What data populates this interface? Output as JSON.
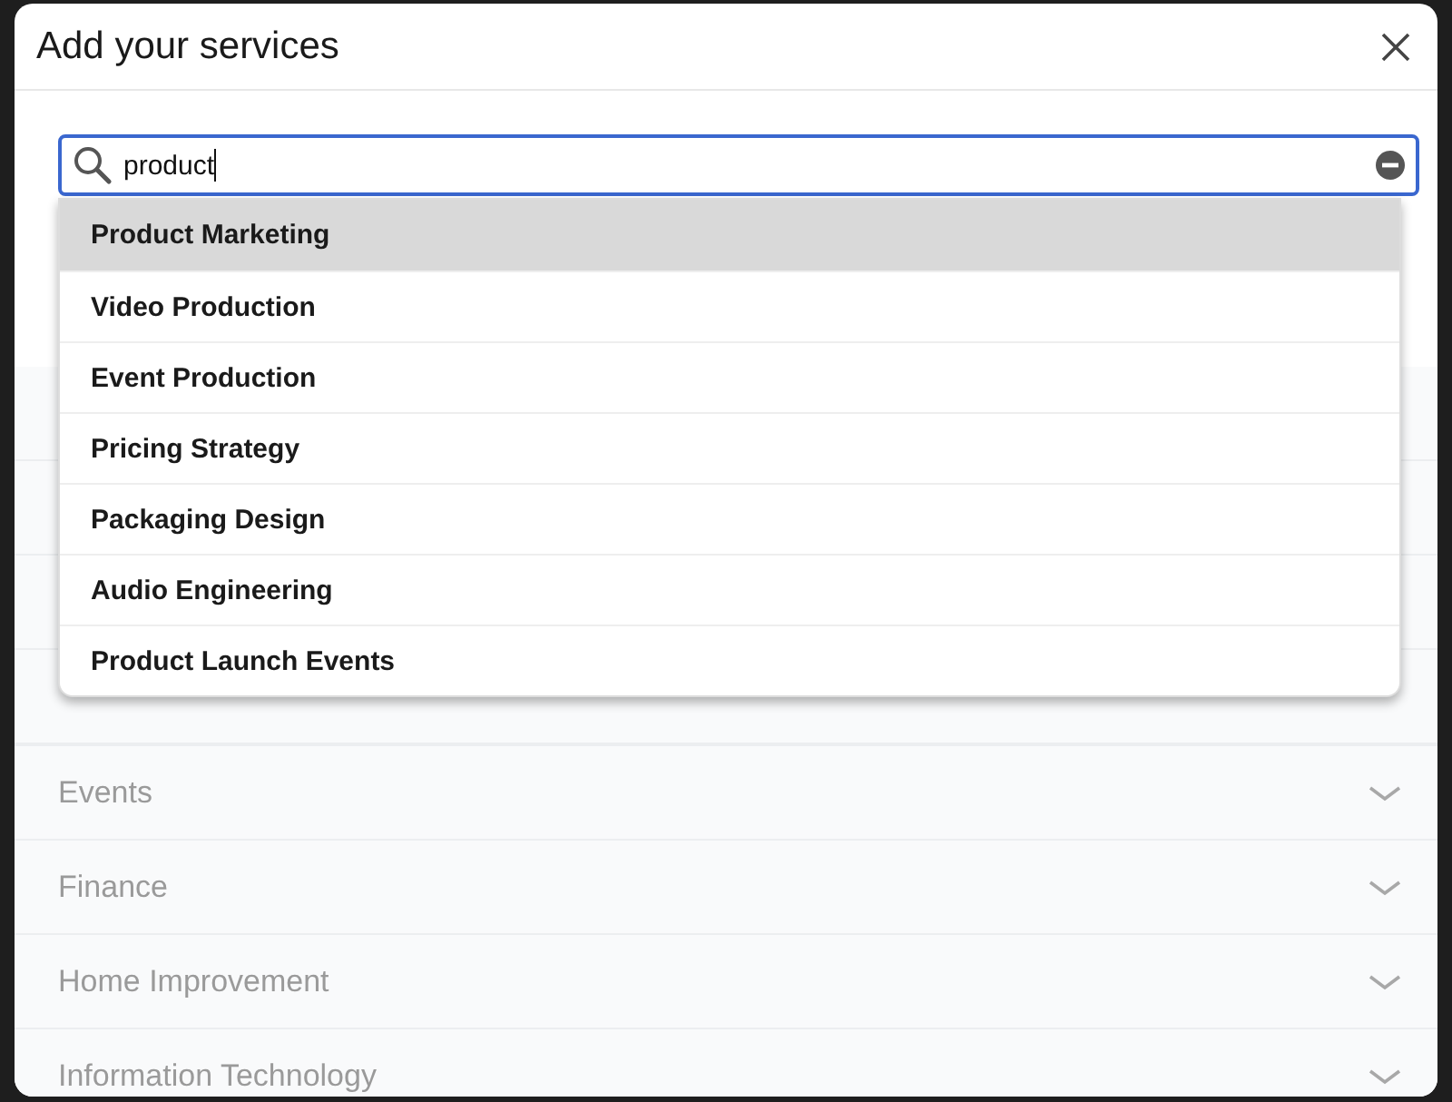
{
  "dialog": {
    "title": "Add your services"
  },
  "search": {
    "value": "product"
  },
  "suggestions": [
    {
      "label": "Product Marketing",
      "selected": true
    },
    {
      "label": "Video Production",
      "selected": false
    },
    {
      "label": "Event Production",
      "selected": false
    },
    {
      "label": "Pricing Strategy",
      "selected": false
    },
    {
      "label": "Packaging Design",
      "selected": false
    },
    {
      "label": "Audio Engineering",
      "selected": false
    },
    {
      "label": "Product Launch Events",
      "selected": false
    }
  ],
  "categories": [
    {
      "label": "Events",
      "expanded": false
    },
    {
      "label": "Finance",
      "expanded": false
    },
    {
      "label": "Home Improvement",
      "expanded": false
    },
    {
      "label": "Information Technology",
      "expanded": false
    }
  ]
}
